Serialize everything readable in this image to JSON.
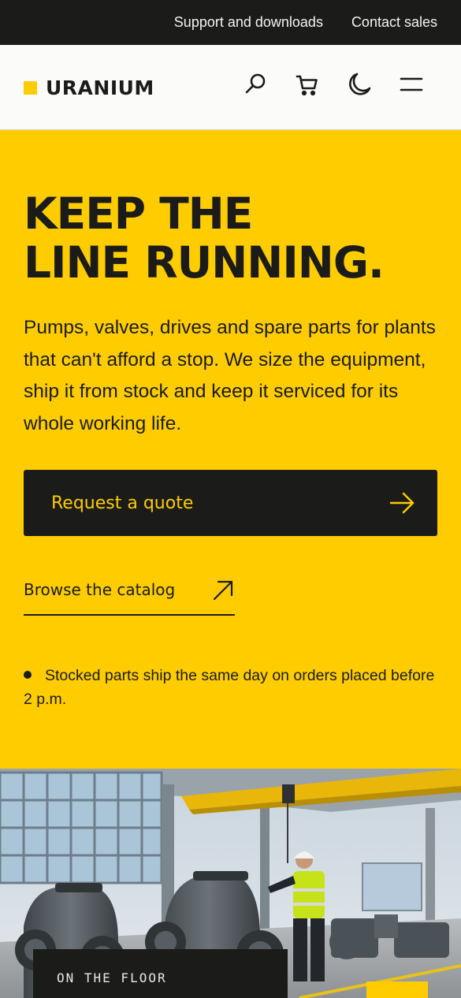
{
  "topbar": {
    "links": [
      "Support and downloads",
      "Contact sales"
    ]
  },
  "header": {
    "brand": "URANIUM",
    "icons": [
      "search-icon",
      "cart-icon",
      "dark-mode-icon",
      "menu-icon"
    ]
  },
  "hero": {
    "title_line1": "KEEP THE",
    "title_line2": "LINE RUNNING.",
    "text": "Pumps, valves, drives and spare parts for plants that can't afford a stop. We size the equipment, ship it from stock and keep it serviced for its whole working life.",
    "primary_cta": "Request a quote",
    "secondary_cta": "Browse the catalog",
    "note": "Stocked parts ship the same day on orders placed before 2 p.m."
  },
  "floor_card": {
    "label": "ON THE FLOOR"
  },
  "colors": {
    "accent": "#ffcc00",
    "dark": "#1b1c1a",
    "surface": "#fbfbf9"
  }
}
